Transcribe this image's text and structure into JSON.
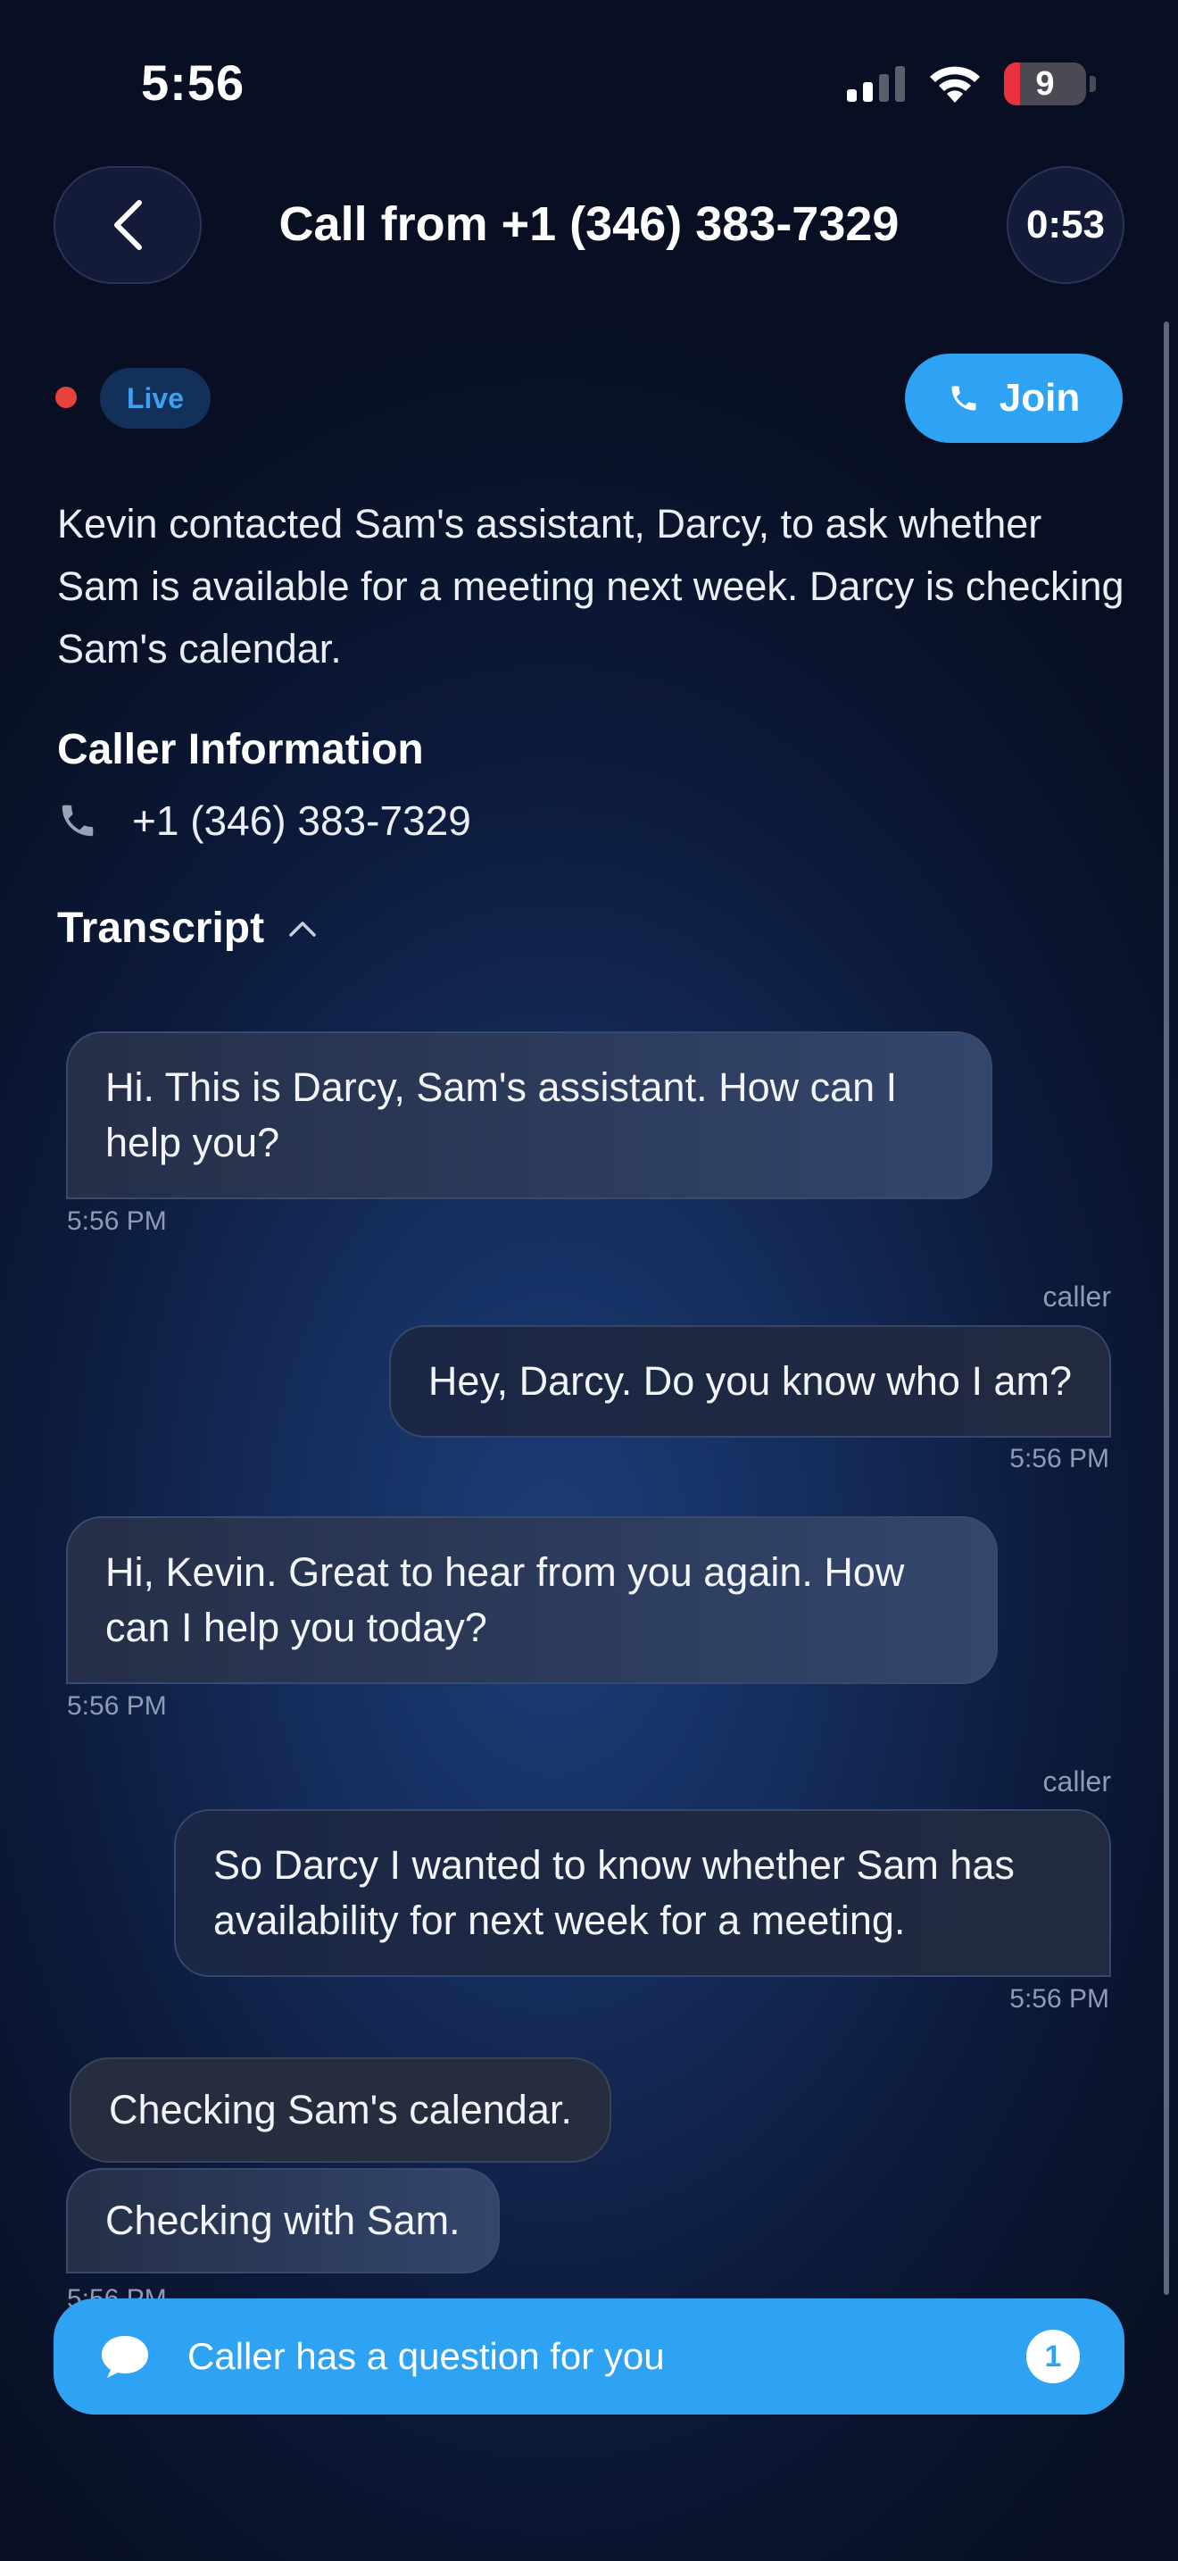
{
  "status_bar": {
    "time": "5:56",
    "battery": "9"
  },
  "header": {
    "title": "Call from +1 (346) 383-7329",
    "timer": "0:53"
  },
  "live_label": "Live",
  "join_label": "Join",
  "summary": "Kevin contacted Sam's assistant, Darcy, to ask whether Sam is available for a meeting next week. Darcy is checking Sam's calendar.",
  "caller_info": {
    "heading": "Caller Information",
    "phone": "+1 (346) 383-7329"
  },
  "transcript": {
    "heading": "Transcript",
    "messages": [
      {
        "from": "assistant",
        "text": "Hi. This is Darcy, Sam's assistant. How can I help you?",
        "time": "5:56 PM"
      },
      {
        "from": "caller",
        "sender": "caller",
        "text": "Hey, Darcy. Do you know who I am?",
        "time": "5:56 PM"
      },
      {
        "from": "assistant",
        "text": "Hi, Kevin. Great to hear from you again. How can I help you today?",
        "time": "5:56 PM"
      },
      {
        "from": "caller",
        "sender": "caller",
        "text": "So Darcy I wanted to know whether Sam has availability for next week for a meeting.",
        "time": "5:56 PM"
      },
      {
        "from": "assistant",
        "text": "Checking Sam's calendar."
      },
      {
        "from": "assistant",
        "text": "Checking with Sam.",
        "time": "5:56 PM"
      }
    ]
  },
  "notification": {
    "text": "Caller has a question for you",
    "count": "1"
  },
  "colors": {
    "accent": "#2ea2f3",
    "live_dot": "#e8423d",
    "background": "#0c1a3a"
  }
}
